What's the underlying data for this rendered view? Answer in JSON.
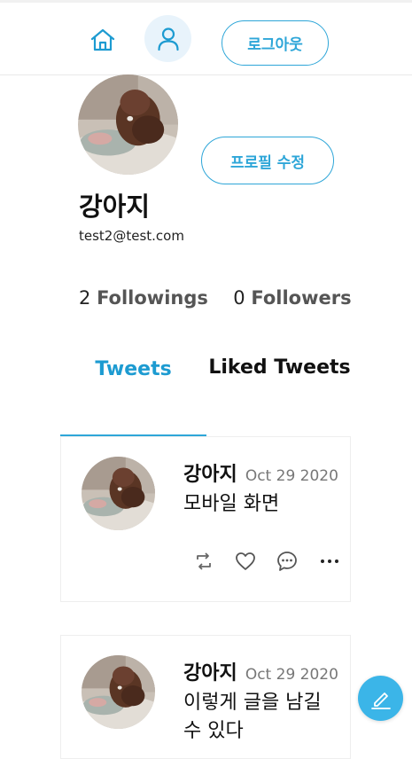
{
  "header": {
    "home_icon": "home-icon",
    "profile_icon": "user-icon",
    "logout_label": "로그아웃"
  },
  "profile": {
    "edit_label": "프로필 수정",
    "name": "강아지",
    "email": "test2@test.com",
    "followings_count": "2",
    "followings_label": "Followings",
    "followers_count": "0",
    "followers_label": "Followers"
  },
  "tabs": [
    {
      "label": "Tweets",
      "active": true
    },
    {
      "label": "Liked Tweets",
      "active": false
    }
  ],
  "tweets": [
    {
      "name": "강아지",
      "date": "Oct 29 2020",
      "text": "모바일 화면"
    },
    {
      "name": "강아지",
      "date": "Oct 29 2020",
      "text": "이렇게 글을 남길 수 있다"
    }
  ],
  "icons": {
    "retweet": "retweet-icon",
    "like": "heart-icon",
    "comment": "comment-icon",
    "more": "more-icon",
    "compose": "pencil-icon"
  },
  "colors": {
    "accent": "#2ea6d8",
    "tab_active": "#1d9bd1",
    "fab": "#3bb5e8"
  }
}
